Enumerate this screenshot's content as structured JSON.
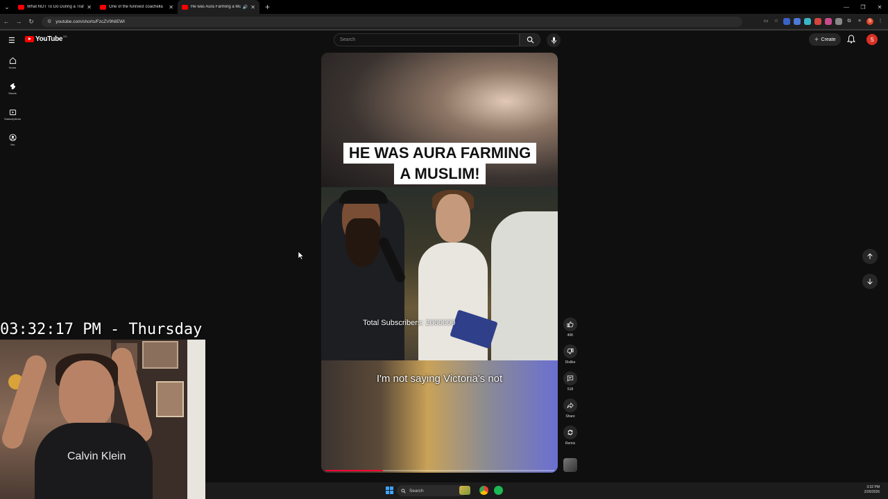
{
  "browser": {
    "tabs": [
      {
        "label": "What NOT To Do During a Traf",
        "active": false
      },
      {
        "label": "One of the funniest coachella",
        "active": false
      },
      {
        "label": "He was Aura Farming a Mu",
        "active": true
      }
    ],
    "url": "youtube.com/shorts/FzcZV9NIEWI",
    "new_tab": "+",
    "profile_initial": "S"
  },
  "youtube": {
    "logo_text": "YouTube",
    "logo_country": "BD",
    "search_placeholder": "Search",
    "create_label": "Create",
    "avatar_initial": "S",
    "guide": [
      {
        "label": "Home",
        "icon": "home-icon"
      },
      {
        "label": "Shorts",
        "icon": "shorts-icon"
      },
      {
        "label": "Subscriptions",
        "icon": "subscriptions-icon"
      },
      {
        "label": "You",
        "icon": "you-icon"
      }
    ]
  },
  "short": {
    "headline_line1": "HE WAS AURA FARMING",
    "headline_line2": "A MUSLIM!",
    "overlay_text": "Total Subscribers: 2060000",
    "caption": "I'm not saying Victoria's not",
    "progress_fraction": 0.25,
    "actions": [
      {
        "label": "40K",
        "icon": "like-icon"
      },
      {
        "label": "Dislike",
        "icon": "dislike-icon"
      },
      {
        "label": "518",
        "icon": "comment-icon"
      },
      {
        "label": "Share",
        "icon": "share-icon"
      },
      {
        "label": "Remix",
        "icon": "remix-icon"
      }
    ]
  },
  "stream_overlay": {
    "clock": "03:32:17 PM - Thursday",
    "shirt_text": "Calvin Klein"
  },
  "taskbar": {
    "search_label": "Search",
    "time": "3:32 PM",
    "date": "2/26/2026"
  }
}
